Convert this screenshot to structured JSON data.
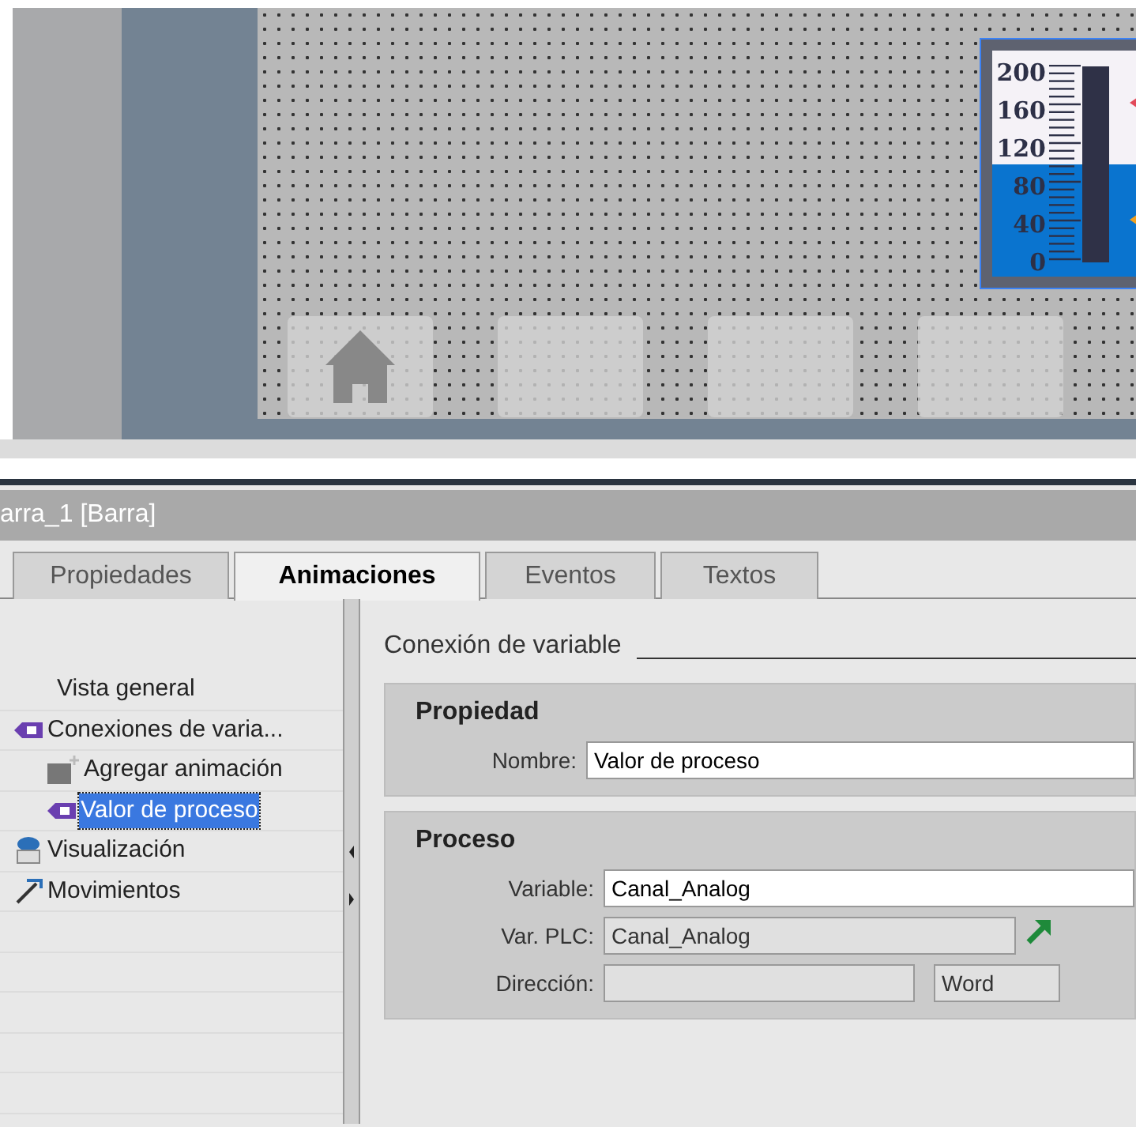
{
  "canvas": {
    "bar_widget": {
      "scale": [
        "200",
        "160",
        "120",
        "80",
        "40",
        "0"
      ],
      "level": 0.5
    }
  },
  "inspector": {
    "title": "arra_1 [Barra]",
    "tabs": [
      {
        "label": "Propiedades",
        "selected": false
      },
      {
        "label": "Animaciones",
        "selected": true
      },
      {
        "label": "Eventos",
        "selected": false
      },
      {
        "label": "Textos",
        "selected": false
      }
    ],
    "tree": [
      {
        "label": "Vista general",
        "kind": "plain",
        "selected": false
      },
      {
        "label": "Conexiones de varia...",
        "kind": "tag",
        "selected": false,
        "children": [
          {
            "label": "Agregar animación",
            "kind": "add",
            "selected": false
          },
          {
            "label": "Valor de proceso",
            "kind": "tag",
            "selected": true
          }
        ]
      },
      {
        "label": "Visualización",
        "kind": "visual",
        "selected": false
      },
      {
        "label": "Movimientos",
        "kind": "move",
        "selected": false
      }
    ],
    "section_title": "Conexión de variable",
    "groups": [
      {
        "title": "Propiedad",
        "fields": [
          {
            "label": "Nombre:",
            "value": "Valor de proceso",
            "kind": "input"
          }
        ]
      },
      {
        "title": "Proceso",
        "fields": [
          {
            "label": "Variable:",
            "value": "Canal_Analog",
            "kind": "input"
          },
          {
            "label": "Var. PLC:",
            "value": "Canal_Analog",
            "kind": "link"
          },
          {
            "label": "Dirección:",
            "type_value": "Word",
            "kind": "address"
          }
        ]
      }
    ]
  }
}
